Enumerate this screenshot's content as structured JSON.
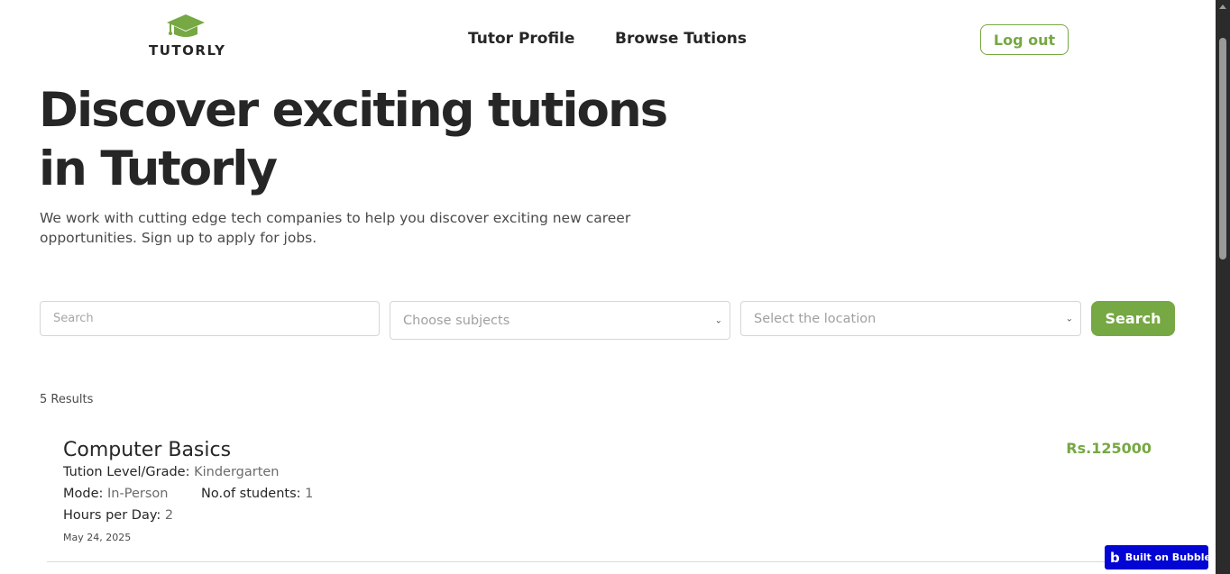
{
  "header": {
    "logo_text": "TUTORLY",
    "logo_icon": "graduation-cap-icon",
    "nav": [
      {
        "label": "Tutor Profile"
      },
      {
        "label": "Browse Tutions"
      }
    ],
    "logout_label": "Log out"
  },
  "hero": {
    "title_line1": "Discover exciting tutions",
    "title_line2": "in Tutorly",
    "subtitle": "We work with cutting edge tech companies to help you discover exciting new career opportunities. Sign up to apply for jobs."
  },
  "search": {
    "placeholder": "Search",
    "subjects_placeholder": "Choose subjects",
    "location_placeholder": "Select the location",
    "button_label": "Search"
  },
  "results": {
    "count_label": "5 Results",
    "items": [
      {
        "title": "Computer Basics",
        "price": "Rs.125000",
        "level_label": "Tution Level/Grade:",
        "level_value": "Kindergarten",
        "mode_label": "Mode:",
        "mode_value": "In-Person",
        "students_label": "No.of students:",
        "students_value": "1",
        "hours_label": "Hours per Day:",
        "hours_value": "2",
        "date": "May 24, 2025"
      }
    ]
  },
  "badge": {
    "label": "Built on Bubble",
    "icon": "bubble-b-icon"
  },
  "colors": {
    "accent": "#76a843",
    "text": "#262626",
    "badge_bg": "#0205d3"
  }
}
